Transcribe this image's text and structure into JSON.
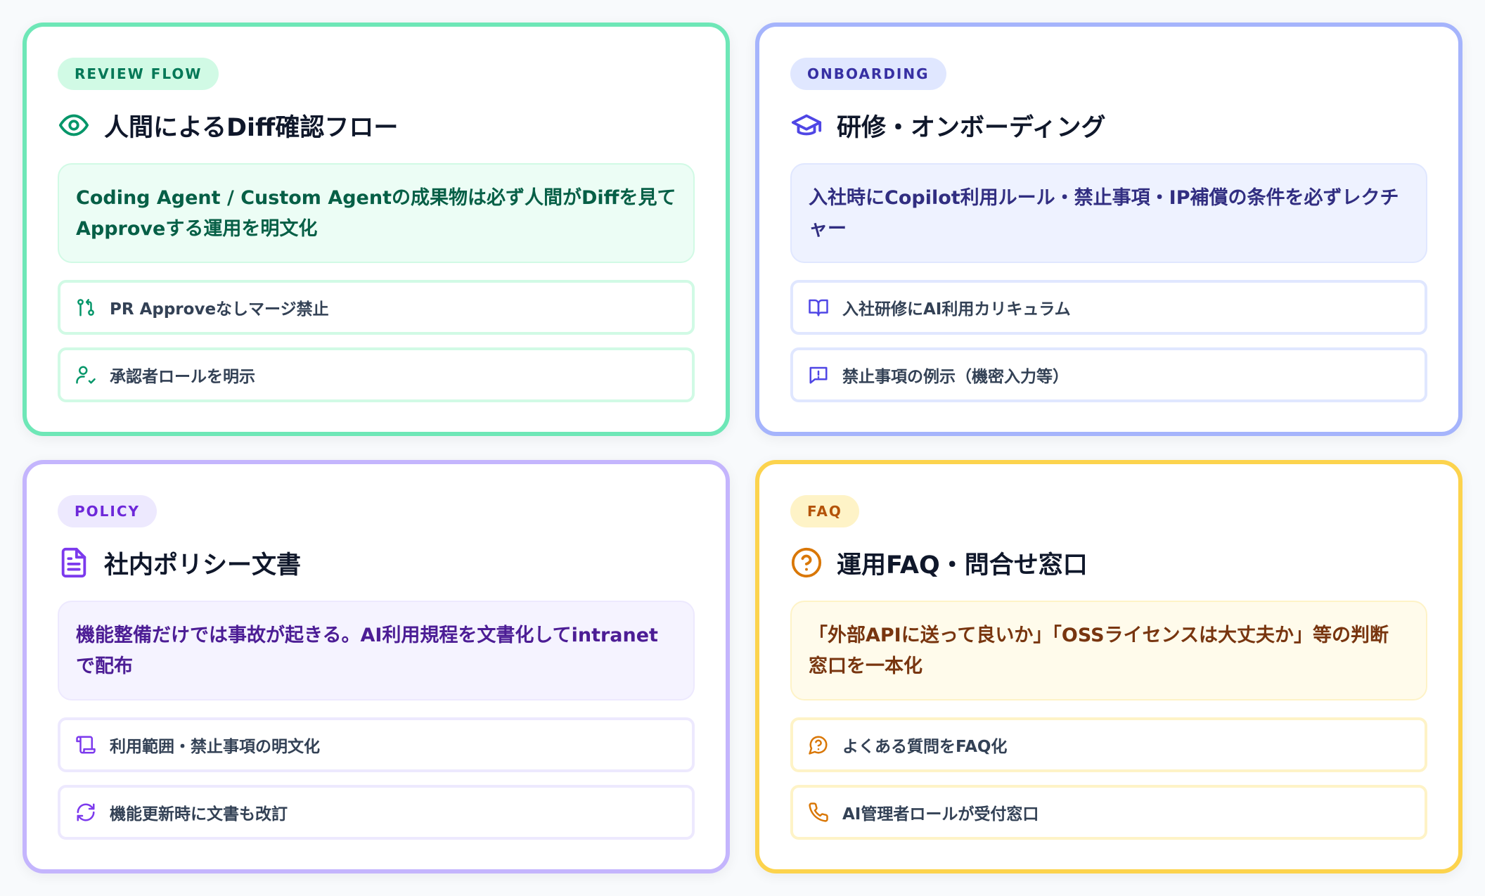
{
  "cards": [
    {
      "tag": "REVIEW FLOW",
      "title": "人間によるDiff確認フロー",
      "icon": "eye-icon",
      "summary_line1": "Coding Agent / Custom Agentの成果物は必ず人間がDiffを見て",
      "summary_line2": "Approveする運用を明文化",
      "items": [
        {
          "label": "PR Approveなしマージ禁止",
          "icon": "git-pull-request-icon"
        },
        {
          "label": "承認者ロールを明示",
          "icon": "user-check-icon"
        }
      ],
      "accent": "#34d399"
    },
    {
      "tag": "ONBOARDING",
      "title": "研修・オンボーディング",
      "icon": "graduation-cap-icon",
      "summary_line1": "入社時にCopilot利用ルール・禁止事項・IP補償の条件を必ずレクチ",
      "summary_line2": "ャー",
      "items": [
        {
          "label": "入社研修にAI利用カリキュラム",
          "icon": "book-open-icon"
        },
        {
          "label": "禁止事項の例示（機密入力等）",
          "icon": "message-alert-icon"
        }
      ],
      "accent": "#818cf8"
    },
    {
      "tag": "POLICY",
      "title": "社内ポリシー文書",
      "icon": "file-text-icon",
      "summary_line1": "機能整備だけでは事故が起きる。AI利用規程を文書化してintranet",
      "summary_line2": "で配布",
      "items": [
        {
          "label": "利用範囲・禁止事項の明文化",
          "icon": "scroll-icon"
        },
        {
          "label": "機能更新時に文書も改訂",
          "icon": "refresh-icon"
        }
      ],
      "accent": "#a78bfa"
    },
    {
      "tag": "FAQ",
      "title": "運用FAQ・問合せ窓口",
      "icon": "help-circle-icon",
      "summary_line1": "「外部APIに送って良いか」「OSSライセンスは大丈夫か」等の判断",
      "summary_line2": "窓口を一本化",
      "items": [
        {
          "label": "よくある質問をFAQ化",
          "icon": "message-question-icon"
        },
        {
          "label": "AI管理者ロールが受付窓口",
          "icon": "phone-icon"
        }
      ],
      "accent": "#fbbf24"
    }
  ]
}
